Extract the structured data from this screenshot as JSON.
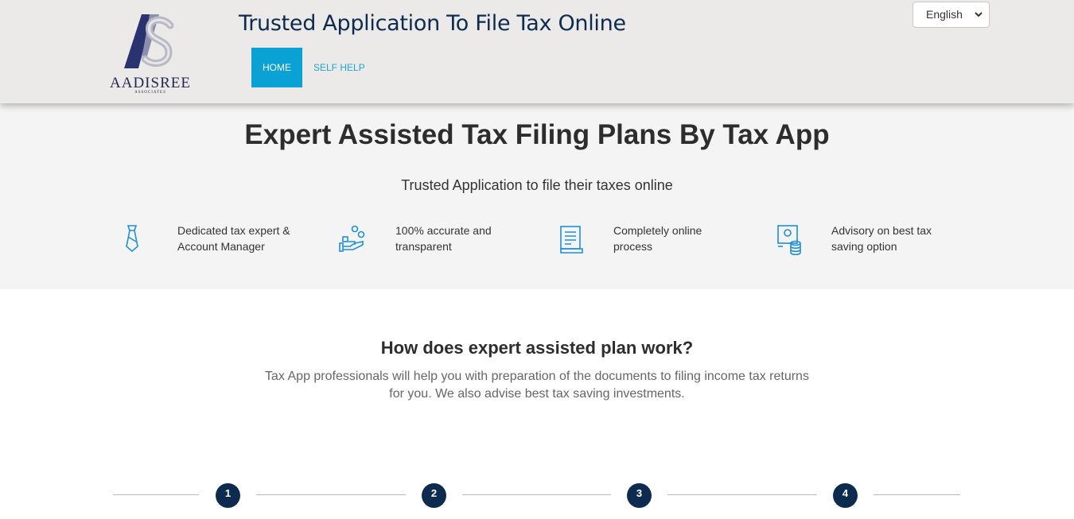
{
  "header": {
    "logo_text": "AADISREE",
    "logo_sub": "ASSOCIATES",
    "title": "Trusted Application To File Tax Online",
    "nav": [
      {
        "label": "HOME",
        "active": true
      },
      {
        "label": "SELF HELP",
        "active": false
      }
    ],
    "language": {
      "selected": "English"
    }
  },
  "hero": {
    "title": "Expert Assisted Tax Filing Plans By Tax App",
    "subtitle": "Trusted Application to file their taxes online",
    "features": [
      {
        "icon": "tie-icon",
        "line1": "Dedicated tax expert &",
        "line2": "Account Manager"
      },
      {
        "icon": "hand-coins-icon",
        "line1": "100% accurate and",
        "line2": "transparent"
      },
      {
        "icon": "document-icon",
        "line1": "Completely online",
        "line2": "process"
      },
      {
        "icon": "monitor-coins-icon",
        "line1": "Advisory on best tax",
        "line2": "saving option"
      }
    ]
  },
  "how": {
    "title": "How does expert assisted plan work?",
    "description": "Tax App professionals will help you with preparation of the documents to filing income tax returns for you. We also advise best tax saving investments.",
    "steps": [
      "1",
      "2",
      "3",
      "4"
    ]
  },
  "colors": {
    "accent": "#0aa1d5",
    "navy": "#0c2b4e",
    "icon_blue": "#1f8fd6"
  }
}
